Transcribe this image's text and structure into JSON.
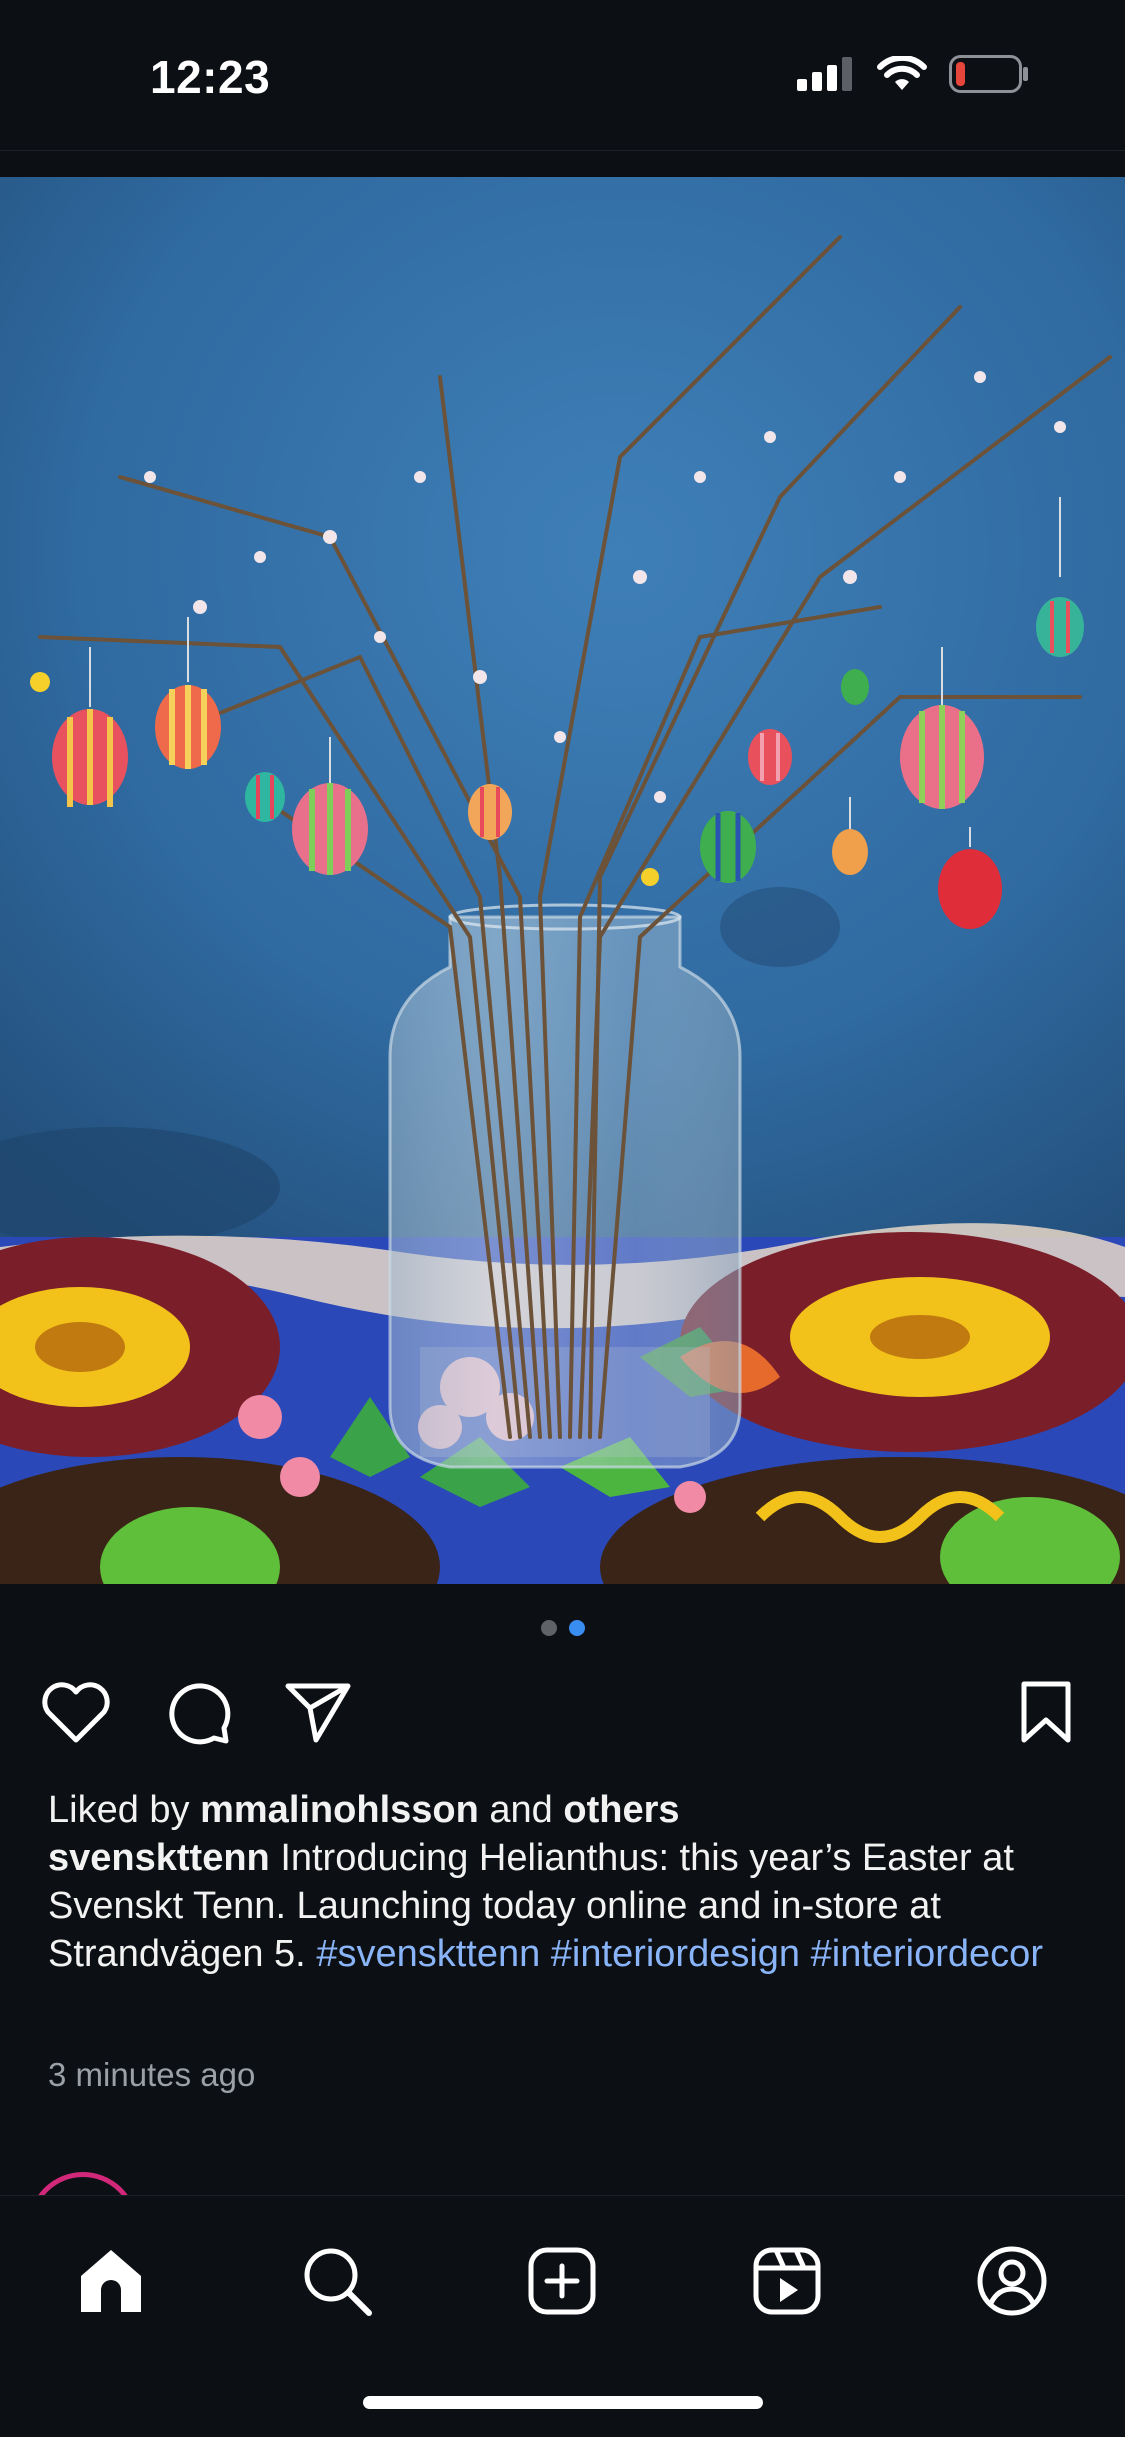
{
  "status_bar": {
    "time": "12:23",
    "icons": [
      "cellular-signal-icon",
      "wifi-icon",
      "battery-low-icon"
    ],
    "battery_color": "#e5453b"
  },
  "post": {
    "image_alt_icon": "photo",
    "carousel": {
      "count": 2,
      "active_index": 1
    },
    "likes": {
      "prefix": "Liked by",
      "user": "mmalinohlsson",
      "connector": "and",
      "others": "others"
    },
    "caption": {
      "username": "svenskttenn",
      "text": "Introducing Helianthus: this year’s Easter at Svenskt Tenn. Launching today online and in-store at Strandvägen 5.",
      "hashtags": [
        "#svenskttenn",
        "#interiordesign",
        "#interiordecor"
      ]
    },
    "timestamp": "3 minutes ago"
  },
  "actions": {
    "like_icon": "heart-icon",
    "comment_icon": "comment-icon",
    "share_icon": "send-icon",
    "save_icon": "bookmark-icon"
  },
  "tab_bar": {
    "tabs": [
      "home-icon",
      "search-icon",
      "create-icon",
      "reels-icon",
      "profile-icon"
    ],
    "active": "home-icon"
  },
  "colors": {
    "background": "#0c0f14",
    "hashtag": "#8ab4f8",
    "active_dot": "#3a8df0",
    "story_ring": "#d2287a"
  }
}
